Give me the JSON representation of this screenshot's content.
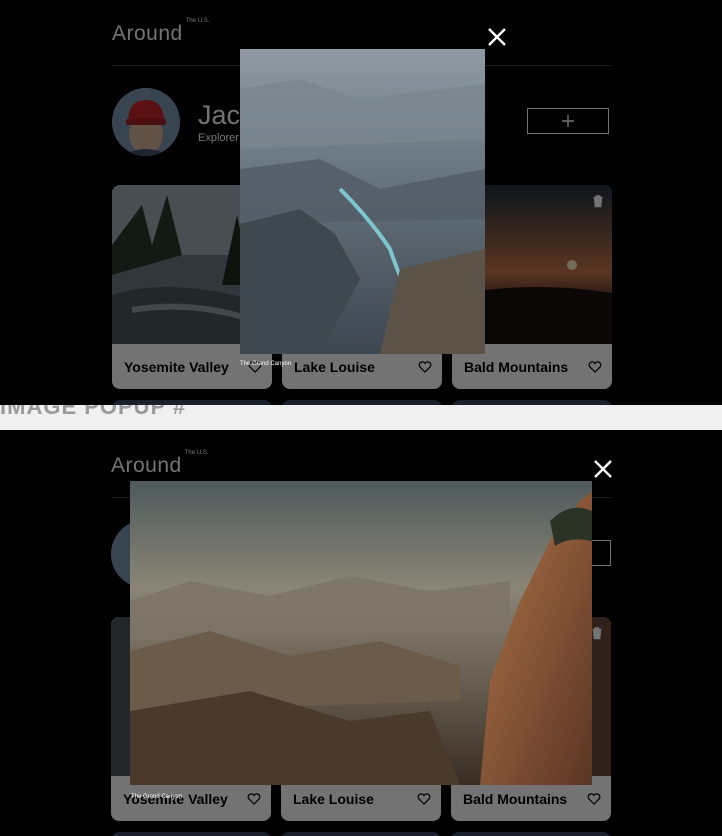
{
  "section_label": "IMAGE POPUP #",
  "header": {
    "logo": "Around",
    "logo_sup": "The U.S."
  },
  "profile": {
    "name": "Jacques Cousteau",
    "job": "Explorer"
  },
  "cards": [
    {
      "caption": "Yosemite Valley"
    },
    {
      "caption": "Lake Louise"
    },
    {
      "caption": "Bald Mountains"
    }
  ],
  "popup": {
    "caption": "The Grand Canyon"
  },
  "icons": {
    "close": "close-icon",
    "add": "plus-icon",
    "like": "heart-icon",
    "delete": "trash-icon"
  },
  "colors": {
    "background": "#000000",
    "card": "#ffffff",
    "divider": "#f0f0f0"
  }
}
